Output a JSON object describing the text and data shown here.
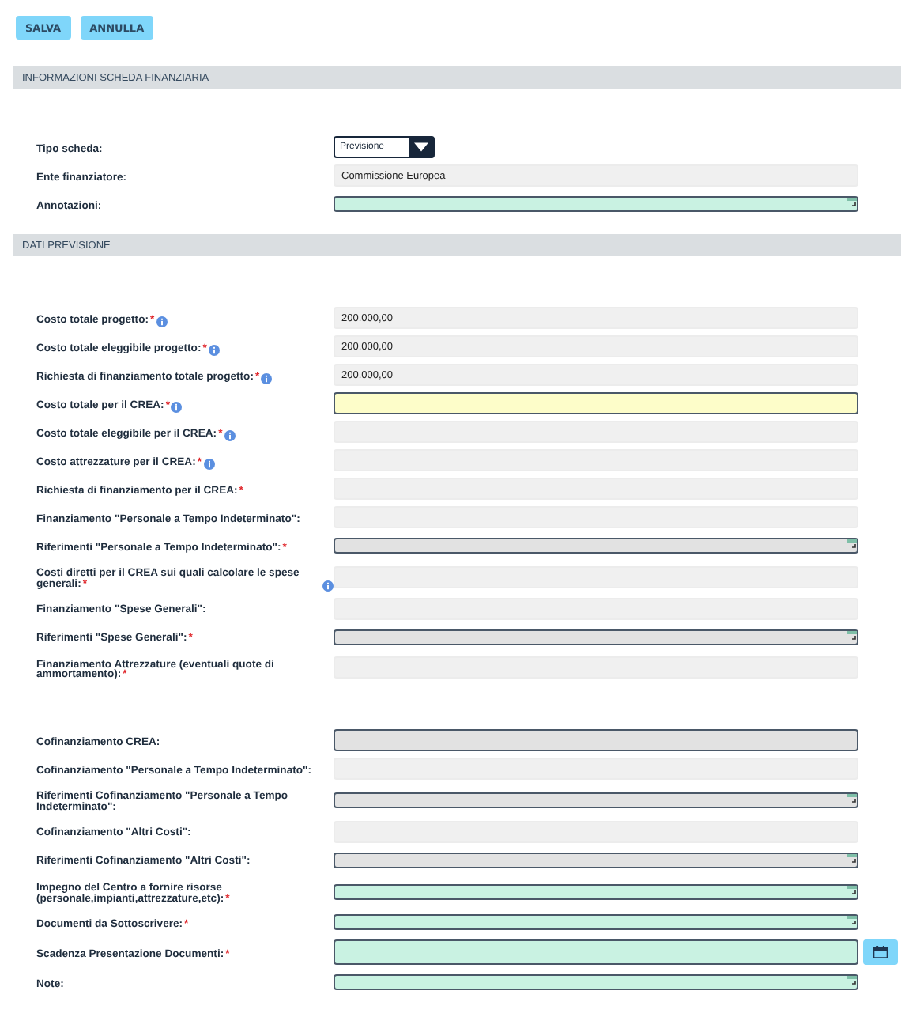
{
  "buttons": [
    "SALVA",
    "ANNULLA"
  ],
  "sections": [
    {
      "title": "INFORMAZIONI SCHEDA FINANZIARIA",
      "fields": [
        {
          "label": "Tipo scheda:",
          "kind": "select",
          "value": "Previsione",
          "info": false,
          "readonly": false,
          "disabled": false,
          "focused": false
        },
        {
          "label": "Ente finanziatore:",
          "kind": "text",
          "value": "Commissione Europea",
          "info": false,
          "readonly": true,
          "disabled": false,
          "focused": false
        },
        {
          "label": "Annotazioni:",
          "kind": "textarea",
          "info": false,
          "readonly": false,
          "disabled": false,
          "focused": false
        }
      ]
    },
    {
      "title": "DATI PREVISIONE",
      "fields": [
        {
          "label": "Costo totale progetto:",
          "marker": "*",
          "kind": "text",
          "value": "200.000,00",
          "info": true,
          "readonly": true,
          "disabled": false,
          "focused": false
        },
        {
          "label": "Costo totale eleggibile progetto:",
          "marker": "*",
          "kind": "text",
          "value": "200.000,00",
          "info": true,
          "readonly": true,
          "disabled": false,
          "focused": false
        },
        {
          "label": "Richiesta di finanziamento totale progetto:",
          "marker": "*",
          "kind": "text",
          "value": "200.000,00",
          "info": true,
          "readonly": true,
          "disabled": false,
          "focused": false
        },
        {
          "label": "Costo totale per il CREA:",
          "marker": "*",
          "kind": "text",
          "info": true,
          "readonly": false,
          "disabled": false,
          "focused": true
        },
        {
          "label": "Costo totale eleggibile per il CREA:",
          "marker": "*",
          "kind": "text",
          "info": true,
          "readonly": true,
          "disabled": false,
          "focused": false
        },
        {
          "label": "Costo attrezzature per il CREA:",
          "marker": "*",
          "kind": "text",
          "info": true,
          "readonly": true,
          "disabled": false,
          "focused": false
        },
        {
          "label": "Richiesta di finanziamento per il CREA:",
          "marker": "*",
          "kind": "text",
          "info": false,
          "readonly": true,
          "disabled": false,
          "focused": false
        },
        {
          "label": "Finanziamento \"Personale a Tempo Indeterminato\":",
          "kind": "text",
          "info": false,
          "readonly": true,
          "disabled": false,
          "focused": false
        },
        {
          "label": "Riferimenti \"Personale a Tempo Indeterminato\":",
          "marker": "*",
          "kind": "textarea",
          "info": false,
          "readonly": false,
          "disabled": true,
          "focused": false
        },
        {
          "label": "Costi diretti per il CREA sui quali calcolare le spese generali:",
          "marker": "*",
          "kind": "text",
          "info": true,
          "readonly": true,
          "disabled": false,
          "focused": false
        },
        {
          "label": "Finanziamento \"Spese Generali\":",
          "kind": "text",
          "info": false,
          "readonly": true,
          "disabled": false,
          "focused": false
        },
        {
          "label": "Riferimenti \"Spese Generali\":",
          "marker": "*",
          "kind": "textarea",
          "info": false,
          "readonly": false,
          "disabled": true,
          "focused": false
        },
        {
          "label": "Finanziamento Attrezzature (eventuali quote di ammortamento):",
          "marker": "*",
          "kind": "text",
          "info": false,
          "readonly": true,
          "disabled": false,
          "focused": false
        },
        {
          "label": "Cofinanziamento CREA:",
          "kind": "text",
          "info": false,
          "readonly": false,
          "disabled": true,
          "focused": false
        },
        {
          "label": "Cofinanziamento \"Personale a Tempo Indeterminato\":",
          "kind": "text",
          "info": false,
          "readonly": true,
          "disabled": false,
          "focused": false
        },
        {
          "label": "Riferimenti Cofinanziamento \"Personale a Tempo Indeterminato\":",
          "kind": "textarea",
          "info": false,
          "readonly": false,
          "disabled": true,
          "focused": false
        },
        {
          "label": "Cofinanziamento \"Altri Costi\":",
          "kind": "text",
          "info": false,
          "readonly": true,
          "disabled": false,
          "focused": false
        },
        {
          "label": "Riferimenti Cofinanziamento \"Altri Costi\":",
          "kind": "textarea",
          "info": false,
          "readonly": false,
          "disabled": true,
          "focused": false
        },
        {
          "label": "Impegno del Centro a fornire risorse (personale,impianti,attrezzature,etc):",
          "marker": "*",
          "kind": "textarea",
          "info": false,
          "readonly": false,
          "disabled": false,
          "focused": false
        },
        {
          "label": "Documenti da Sottoscrivere:",
          "marker": "*",
          "kind": "textarea",
          "info": false,
          "readonly": false,
          "disabled": false,
          "focused": false
        },
        {
          "label": "Scadenza Presentazione Documenti:",
          "marker": "*",
          "kind": "date",
          "info": false,
          "readonly": false,
          "disabled": false,
          "focused": false
        },
        {
          "label": "Note:",
          "kind": "textarea",
          "info": false,
          "readonly": false,
          "disabled": false,
          "focused": false
        }
      ]
    }
  ]
}
